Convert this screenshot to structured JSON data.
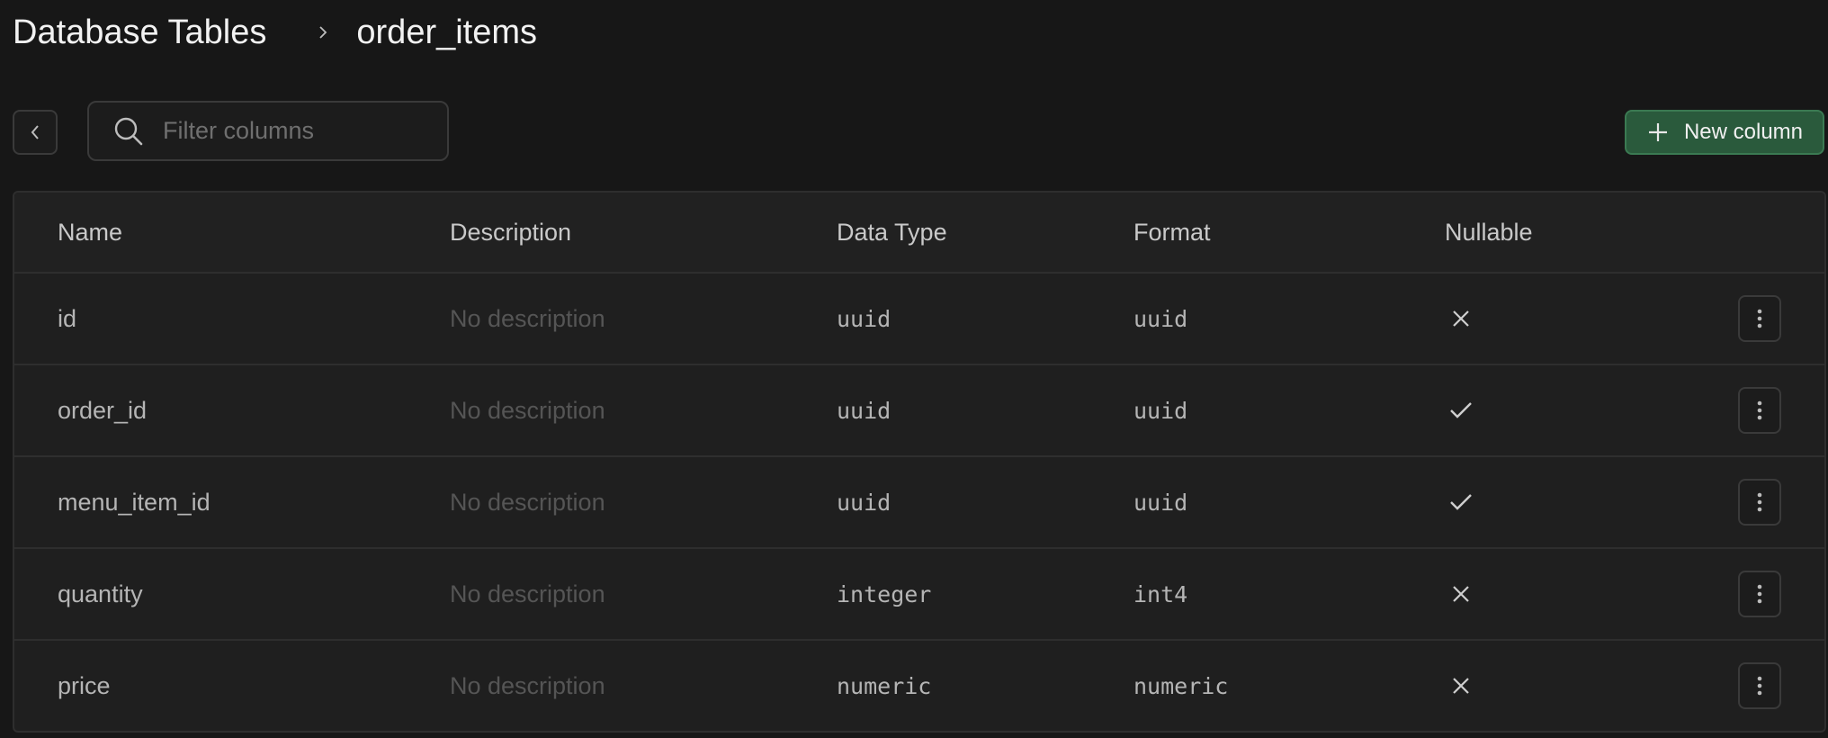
{
  "breadcrumb": {
    "root": "Database Tables",
    "current": "order_items"
  },
  "toolbar": {
    "search_placeholder": "Filter columns",
    "new_column_label": "New column"
  },
  "colors": {
    "background": "#171717",
    "table_bg": "#1f1f1f",
    "border": "#2e2e2e",
    "primary_button_bg": "#2a5a3c",
    "primary_button_border": "#3b7a52",
    "muted_text": "#555555"
  },
  "table": {
    "headers": {
      "name": "Name",
      "description": "Description",
      "data_type": "Data Type",
      "format": "Format",
      "nullable": "Nullable"
    },
    "rows": [
      {
        "name": "id",
        "description": "No description",
        "data_type": "uuid",
        "format": "uuid",
        "nullable": false
      },
      {
        "name": "order_id",
        "description": "No description",
        "data_type": "uuid",
        "format": "uuid",
        "nullable": true
      },
      {
        "name": "menu_item_id",
        "description": "No description",
        "data_type": "uuid",
        "format": "uuid",
        "nullable": true
      },
      {
        "name": "quantity",
        "description": "No description",
        "data_type": "integer",
        "format": "int4",
        "nullable": false
      },
      {
        "name": "price",
        "description": "No description",
        "data_type": "numeric",
        "format": "numeric",
        "nullable": false
      }
    ]
  }
}
